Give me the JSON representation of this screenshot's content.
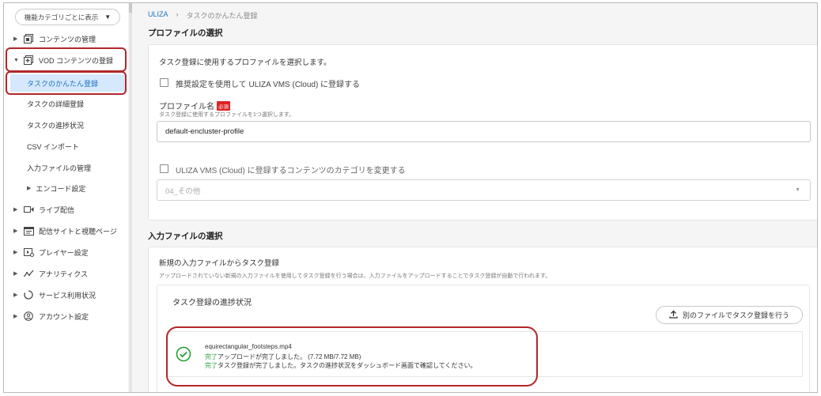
{
  "sidebar": {
    "view_select": "機能カテゴリごとに表示",
    "items": [
      {
        "label": "コンテンツの管理",
        "icon": "content-icon",
        "expanded": false
      },
      {
        "label": "VOD コンテンツの登録",
        "icon": "vod-add-icon",
        "expanded": true
      },
      {
        "label": "タスクのかんたん登録",
        "active": true
      },
      {
        "label": "タスクの詳細登録"
      },
      {
        "label": "タスクの進捗状況"
      },
      {
        "label": "CSV インポート"
      },
      {
        "label": "入力ファイルの管理"
      },
      {
        "label": "エンコード設定"
      },
      {
        "label": "ライブ配信",
        "icon": "live-icon"
      },
      {
        "label": "配信サイトと視聴ページ",
        "icon": "site-icon"
      },
      {
        "label": "プレイヤー設定",
        "icon": "player-icon"
      },
      {
        "label": "アナリティクス",
        "icon": "analytics-icon"
      },
      {
        "label": "サービス利用状況",
        "icon": "usage-icon"
      },
      {
        "label": "アカウント設定",
        "icon": "account-icon"
      }
    ]
  },
  "breadcrumb": {
    "root": "ULIZA",
    "sep": "›",
    "current": "タスクのかんたん登録"
  },
  "profile_section": {
    "title": "プロファイルの選択",
    "description": "タスク登録に使用するプロファイルを選択します。",
    "recommended_checkbox": "推奨設定を使用して ULIZA VMS (Cloud) に登録する",
    "profile_label": "プロファイル名",
    "required_badge": "必須",
    "profile_hint": "タスク登録に使用するプロファイルを1つ選択します。",
    "profile_value": "default-encluster-profile",
    "category_checkbox": "ULIZA VMS (Cloud) に登録するコンテンツのカテゴリを変更する",
    "category_value": "04_その他"
  },
  "input_section": {
    "title": "入力ファイルの選択",
    "subtitle": "新規の入力ファイルからタスク登録",
    "hint": "アップロードされていない新規の入力ファイルを使用してタスク登録を行う場合は、入力ファイルをアップロードすることでタスク登録が自動で行われます。",
    "progress_title": "タスク登録の進捗状況",
    "another_file_button": "別のファイルでタスク登録を行う",
    "file_name": "equirectangular_footsteps.mp4",
    "upload_status": "完了",
    "upload_text": "アップロードが完了しました。 (7.72 MB/7.72 MB)",
    "task_status": "完了",
    "task_text": "タスク登録が完了しました。タスクの進捗状況をダッシュボード画面で確認してください。"
  },
  "colors": {
    "accent": "#1a73c8",
    "success": "#22a134",
    "highlight": "#b3262a",
    "active_bg": "#d6e8fb"
  }
}
